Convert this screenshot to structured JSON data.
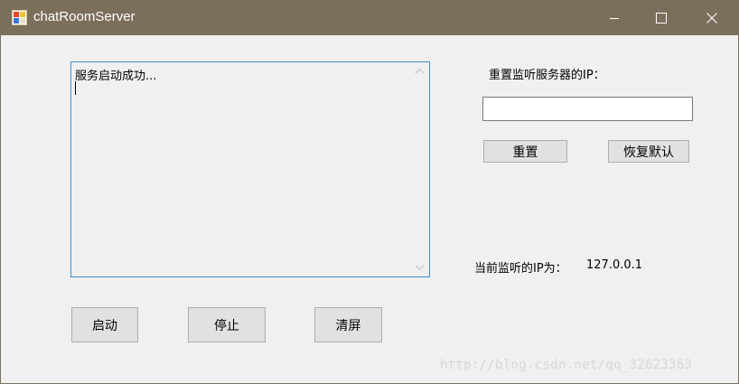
{
  "window": {
    "title": "chatRoomServer",
    "icon": "winforms-app-icon",
    "controls": [
      "minimize-icon",
      "maximize-icon",
      "close-icon"
    ]
  },
  "log": {
    "text": "服务启动成功..."
  },
  "reset_panel": {
    "label": "重置监听服务器的IP：",
    "input_value": "",
    "reset_button": "重置",
    "restore_button": "恢复默认"
  },
  "status": {
    "current_ip_label": "当前监听的IP为：",
    "current_ip": "127.0.0.1"
  },
  "controls": {
    "start_button": "启动",
    "stop_button": "停止",
    "clear_button": "清屏"
  },
  "watermark": "http://blog.csdn.net/qq_32623363"
}
